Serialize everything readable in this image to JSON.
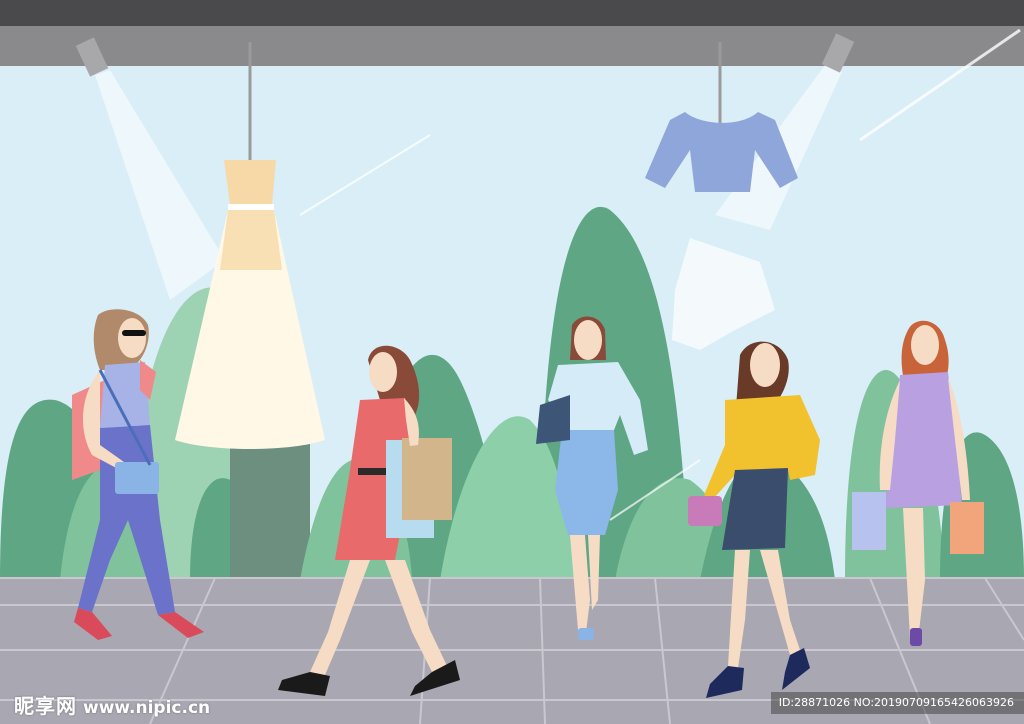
{
  "scene": {
    "description_free": true,
    "colors": {
      "ceiling": "#4a4a4c",
      "ceiling_band": "#8a8a8c",
      "sky": "#d9eef6",
      "floor": "#a9a7b1",
      "floor_lines": "#c9c7cf",
      "hill_dark": "#5ea684",
      "hill_mid": "#7fc29c",
      "hill_light": "#9dd3b3",
      "dress": "#fff8e7",
      "dress_bodice": "#f7d9a8",
      "top_blue": "#8ea6d9"
    },
    "icons": [
      "spotlight-left",
      "spotlight-right",
      "hanging-dress",
      "hanging-top",
      "hanging-skirt"
    ]
  },
  "watermark": {
    "logo": "昵享网",
    "site": "www.nipic.cn",
    "id_text": "ID:28871026 NO:20190709165426063926"
  }
}
